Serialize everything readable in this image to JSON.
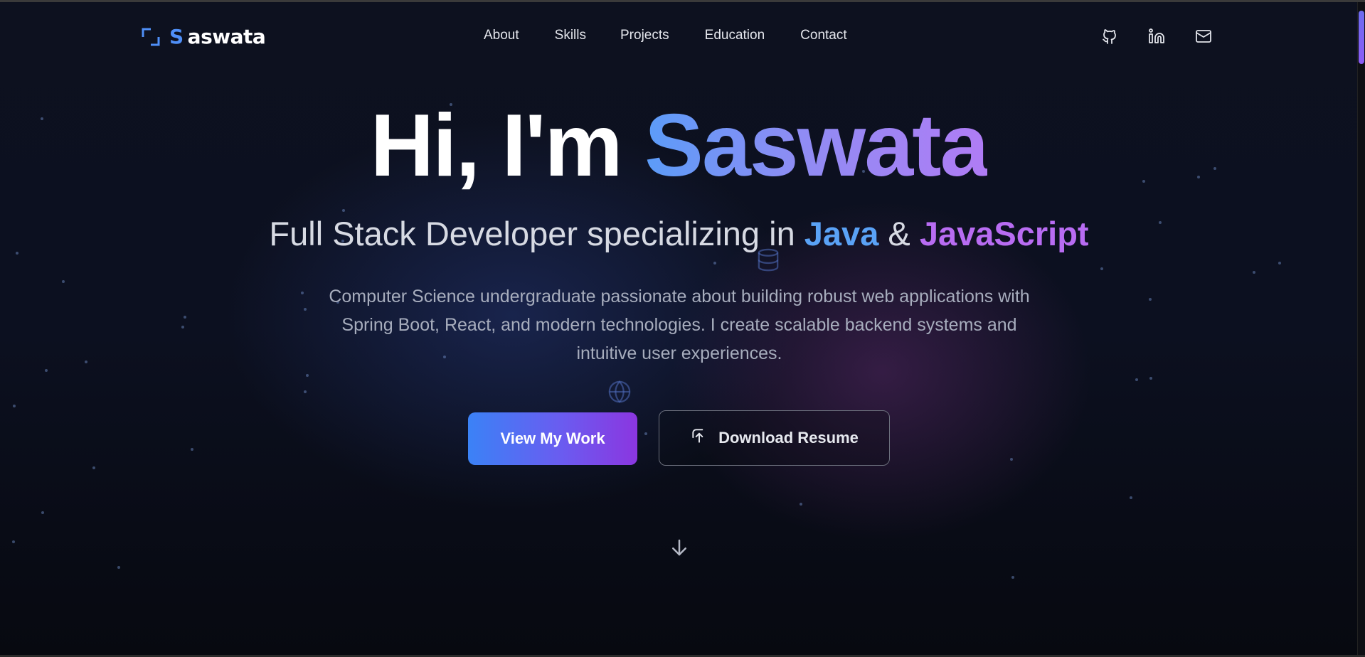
{
  "nav": {
    "logo_initial": "S",
    "logo_rest": "aswata",
    "links": [
      "About",
      "Skills",
      "Projects",
      "Education",
      "Contact"
    ],
    "icons": [
      "github-icon",
      "linkedin-icon",
      "mail-icon"
    ]
  },
  "hero": {
    "greeting": "Hi, I'm ",
    "name": "Saswata",
    "subtitle_prefix": "Full Stack Developer specializing in ",
    "subtitle_java": "Java",
    "subtitle_amp": " & ",
    "subtitle_js": "JavaScript",
    "description": "Computer Science undergraduate passionate about building robust web applications with Spring Boot, React, and modern technologies. I create scalable backend systems and intuitive user experiences.",
    "primary_button": "View My Work",
    "secondary_button": "Download Resume"
  },
  "colors": {
    "accent_blue": "#3b82f6",
    "accent_purple": "#8b36e0",
    "background": "#0c1020"
  },
  "decor_icons": [
    "database-icon",
    "globe-icon",
    "arrow-down-icon"
  ]
}
